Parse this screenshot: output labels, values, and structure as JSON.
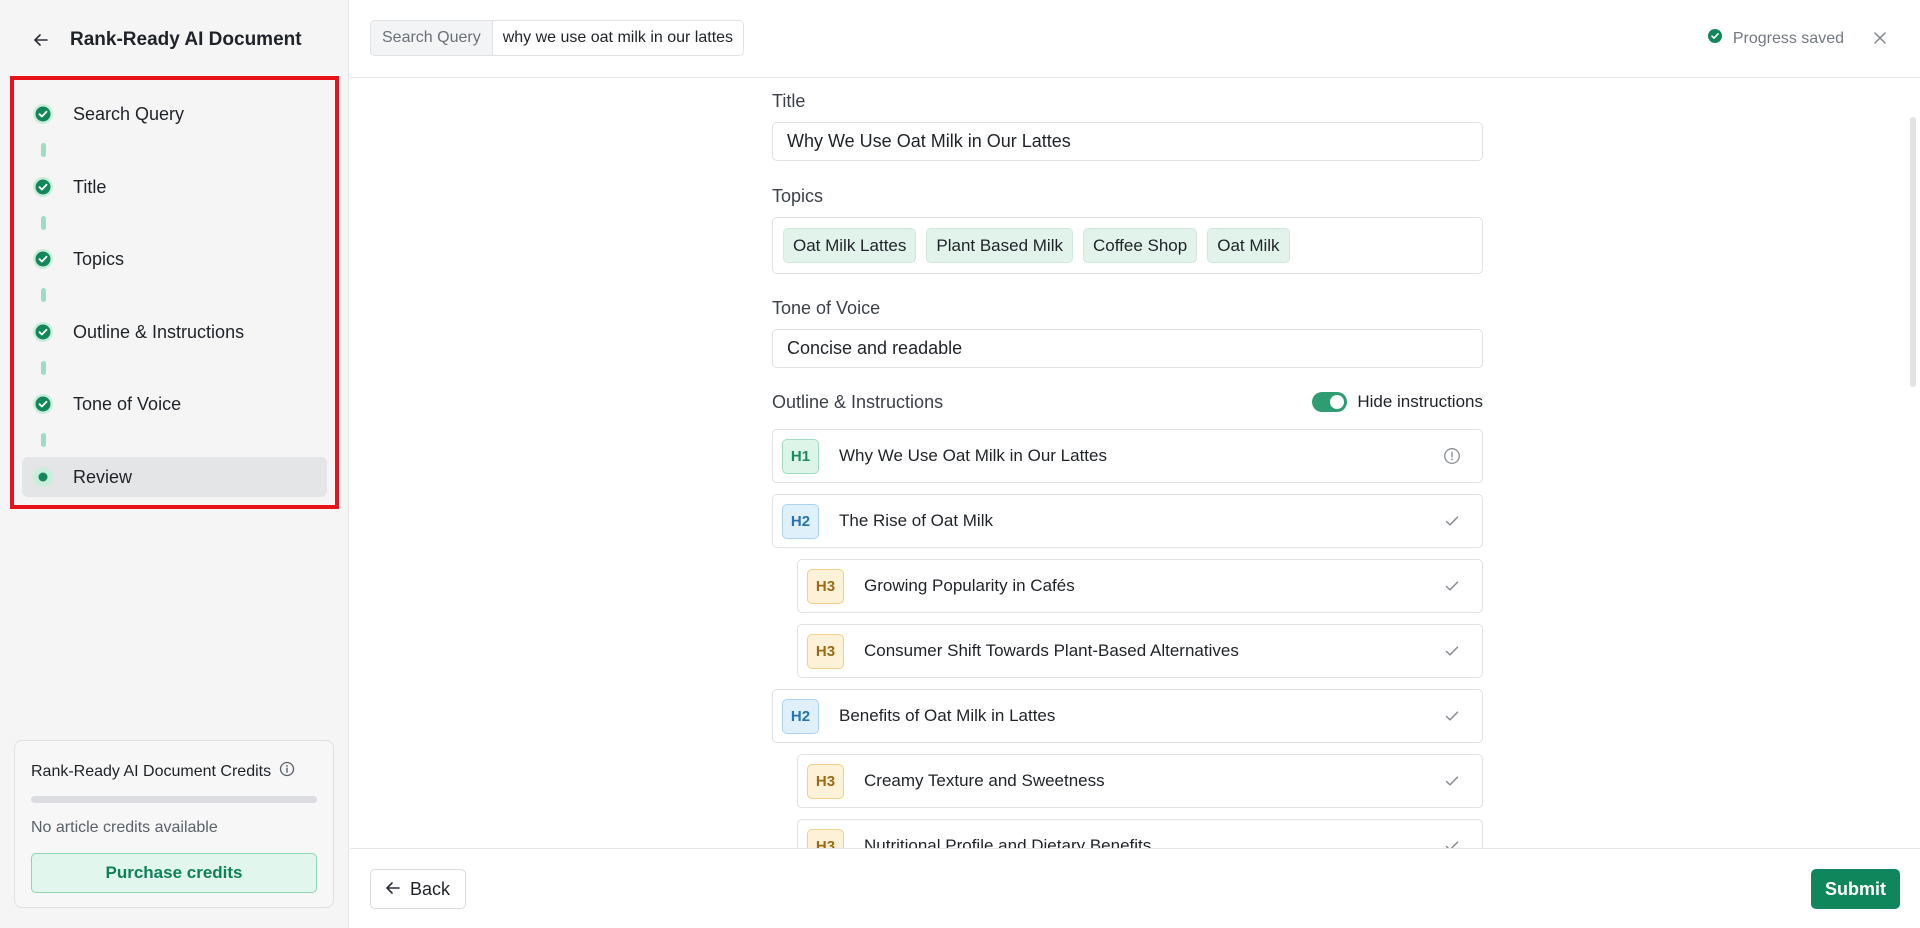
{
  "sidebar": {
    "title": "Rank-Ready AI Document",
    "steps": [
      {
        "label": "Search Query",
        "status": "complete"
      },
      {
        "label": "Title",
        "status": "complete"
      },
      {
        "label": "Topics",
        "status": "complete"
      },
      {
        "label": "Outline & Instructions",
        "status": "complete"
      },
      {
        "label": "Tone of Voice",
        "status": "complete"
      },
      {
        "label": "Review",
        "status": "active"
      }
    ],
    "credits": {
      "title": "Rank-Ready AI Document Credits",
      "usage_fraction": 0,
      "empty_text": "No article credits available",
      "purchase_label": "Purchase credits"
    }
  },
  "topbar": {
    "query_label": "Search Query",
    "query_value": "why we use oat milk in our lattes",
    "progress_text": "Progress saved"
  },
  "form": {
    "title_label": "Title",
    "title_value": "Why We Use Oat Milk in Our Lattes",
    "topics_label": "Topics",
    "topics": [
      "Oat Milk Lattes",
      "Plant Based Milk",
      "Coffee Shop",
      "Oat Milk"
    ],
    "tone_label": "Tone of Voice",
    "tone_value": "Concise and readable",
    "outline_label": "Outline & Instructions",
    "hide_instructions_label": "Hide instructions",
    "hide_instructions_on": true,
    "outline": [
      {
        "level": "H1",
        "text": "Why We Use Oat Milk in Our Lattes",
        "icon": "info-icon"
      },
      {
        "level": "H2",
        "text": "The Rise of Oat Milk",
        "icon": "check-icon"
      },
      {
        "level": "H3",
        "text": "Growing Popularity in Cafés",
        "icon": "check-icon"
      },
      {
        "level": "H3",
        "text": "Consumer Shift Towards Plant-Based Alternatives",
        "icon": "check-icon"
      },
      {
        "level": "H2",
        "text": "Benefits of Oat Milk in Lattes",
        "icon": "check-icon"
      },
      {
        "level": "H3",
        "text": "Creamy Texture and Sweetness",
        "icon": "check-icon"
      },
      {
        "level": "H3",
        "text": "Nutritional Profile and Dietary Benefits",
        "icon": "check-icon"
      }
    ]
  },
  "footer": {
    "back_label": "Back",
    "submit_label": "Submit"
  },
  "colors": {
    "brand_green": "#10865c",
    "highlight_red": "#e8131a"
  }
}
